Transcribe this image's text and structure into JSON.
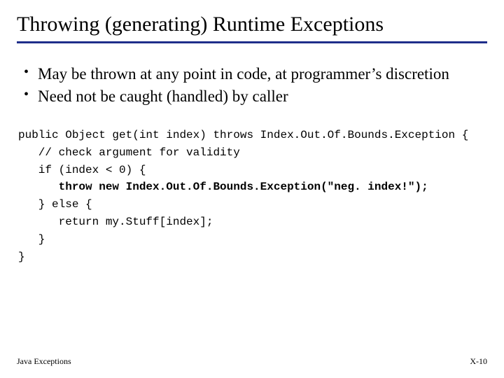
{
  "title": "Throwing (generating) Runtime Exceptions",
  "bullets": [
    "May be thrown at any point in code, at programmer’s discretion",
    "Need not be caught (handled) by caller"
  ],
  "code": {
    "l1": "public Object get(int index) throws Index.Out.Of.Bounds.Exception {",
    "l2": "   // check argument for validity",
    "l3": "   if (index < 0) {",
    "l4": "      throw new Index.Out.Of.Bounds.Exception(\"neg. index!\");",
    "l5": "   } else {",
    "l6": "      return my.Stuff[index];",
    "l7": "   }",
    "l8": "}"
  },
  "footer": {
    "left": "Java Exceptions",
    "right": "X-10"
  }
}
